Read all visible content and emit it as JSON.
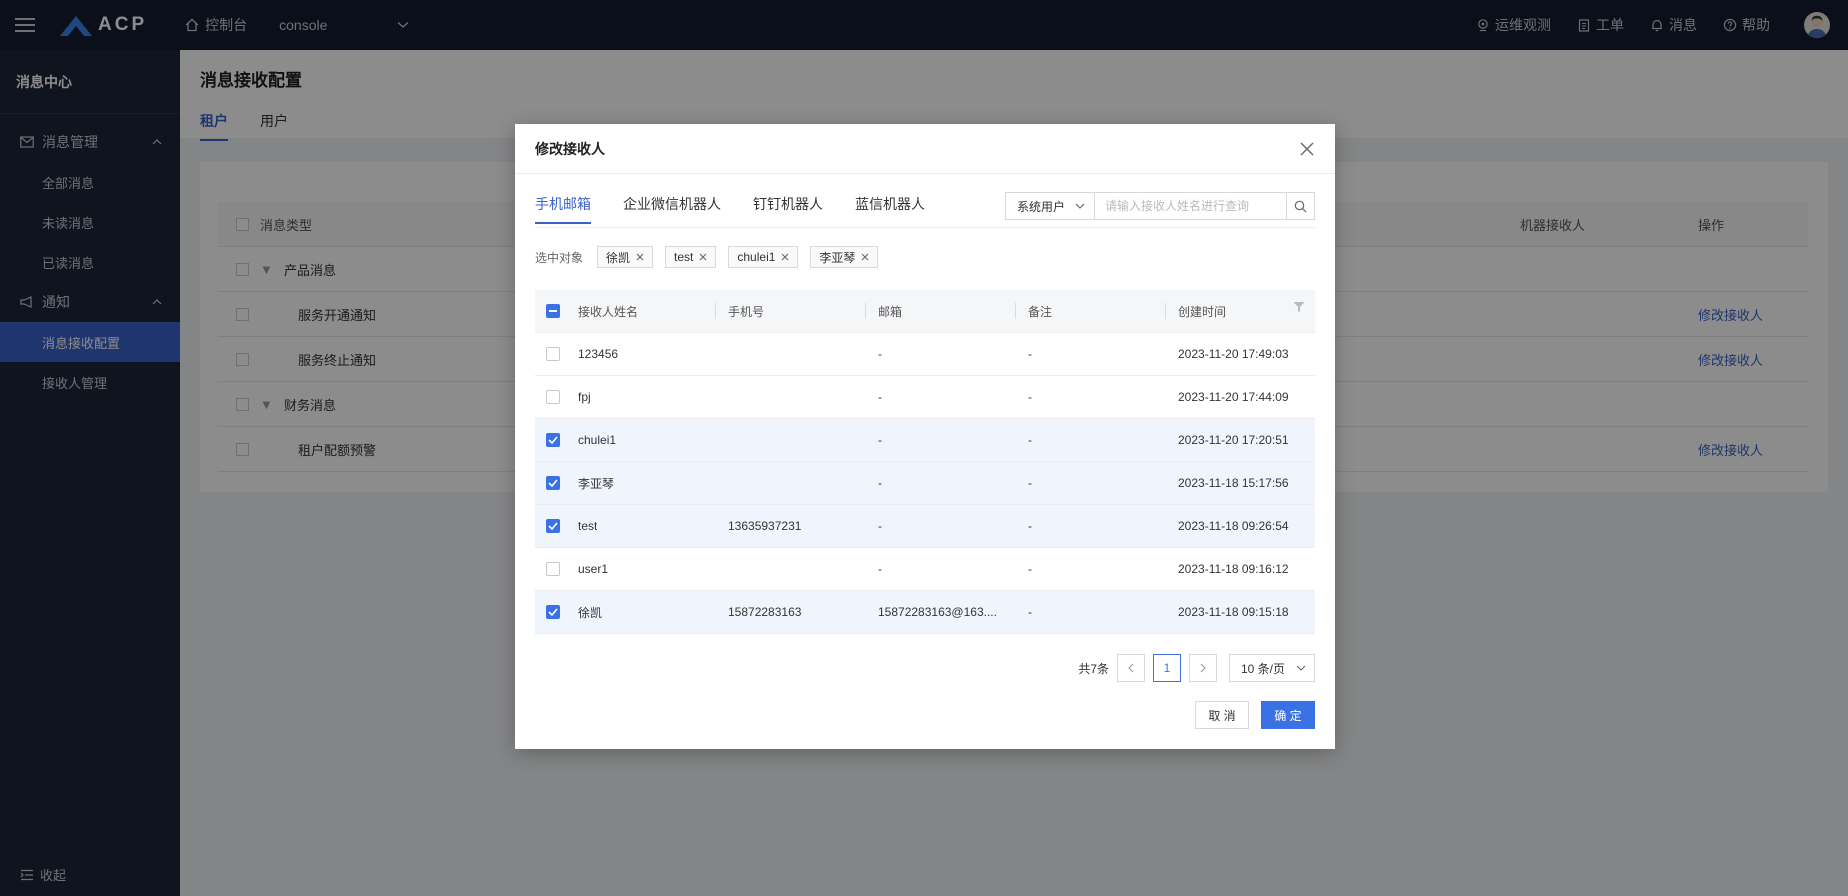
{
  "topbar": {
    "logo_text": "ACP",
    "console_label": "控制台",
    "project_select": "console",
    "right_items": [
      {
        "label": "运维观测",
        "icon": "location-pin-icon"
      },
      {
        "label": "工单",
        "icon": "clipboard-icon"
      },
      {
        "label": "消息",
        "icon": "bell-icon"
      },
      {
        "label": "帮助",
        "icon": "help-circle-icon"
      }
    ]
  },
  "sidebar": {
    "title": "消息中心",
    "groups": [
      {
        "label": "消息管理",
        "icon": "mail-icon",
        "items": [
          "全部消息",
          "未读消息",
          "已读消息"
        ]
      },
      {
        "label": "通知",
        "icon": "megaphone-icon",
        "items": [
          "消息接收配置",
          "接收人管理"
        ]
      }
    ],
    "active_item": "消息接收配置",
    "collapse_label": "收起"
  },
  "main": {
    "title": "消息接收配置",
    "tabs": [
      "租户",
      "用户"
    ],
    "active_tab": "租户",
    "table": {
      "headers": {
        "type": "消息类型",
        "robot": "机器接收人",
        "action": "操作"
      },
      "rows": [
        {
          "label": "产品消息",
          "group": true,
          "action": ""
        },
        {
          "label": "服务开通通知",
          "group": false,
          "action": "修改接收人"
        },
        {
          "label": "服务终止通知",
          "group": false,
          "action": "修改接收人"
        },
        {
          "label": "财务消息",
          "group": true,
          "action": ""
        },
        {
          "label": "租户配额预警",
          "group": false,
          "action": "修改接收人"
        }
      ]
    }
  },
  "modal": {
    "title": "修改接收人",
    "tabs": [
      "手机邮箱",
      "企业微信机器人",
      "钉钉机器人",
      "蓝信机器人"
    ],
    "active_tab": "手机邮箱",
    "search": {
      "select_value": "系统用户",
      "placeholder": "请输入接收人姓名进行查询"
    },
    "selected_label": "选中对象",
    "selected_tags": [
      "徐凯",
      "test",
      "chulei1",
      "李亚琴"
    ],
    "columns": [
      "接收人姓名",
      "手机号",
      "邮箱",
      "备注",
      "创建时间"
    ],
    "rows": [
      {
        "name": "123456",
        "phone": "",
        "email": "-",
        "note": "-",
        "created": "2023-11-20 17:49:03",
        "checked": false
      },
      {
        "name": "fpj",
        "phone": "",
        "email": "-",
        "note": "-",
        "created": "2023-11-20 17:44:09",
        "checked": false
      },
      {
        "name": "chulei1",
        "phone": "",
        "email": "-",
        "note": "-",
        "created": "2023-11-20 17:20:51",
        "checked": true
      },
      {
        "name": "李亚琴",
        "phone": "",
        "email": "-",
        "note": "-",
        "created": "2023-11-18 15:17:56",
        "checked": true
      },
      {
        "name": "test",
        "phone": "13635937231",
        "email": "-",
        "note": "-",
        "created": "2023-11-18 09:26:54",
        "checked": true
      },
      {
        "name": "user1",
        "phone": "",
        "email": "-",
        "note": "-",
        "created": "2023-11-18 09:16:12",
        "checked": false
      },
      {
        "name": "徐凯",
        "phone": "15872283163",
        "email": "15872283163@163....",
        "note": "-",
        "created": "2023-11-18 09:15:18",
        "checked": true
      }
    ],
    "pager": {
      "total": "共7条",
      "current": "1",
      "page_size": "10 条/页"
    },
    "buttons": {
      "cancel": "取 消",
      "ok": "确 定"
    }
  },
  "colors": {
    "accent": "#3a72e6",
    "topbar": "#151c2e",
    "sidebar": "#1d2538"
  }
}
